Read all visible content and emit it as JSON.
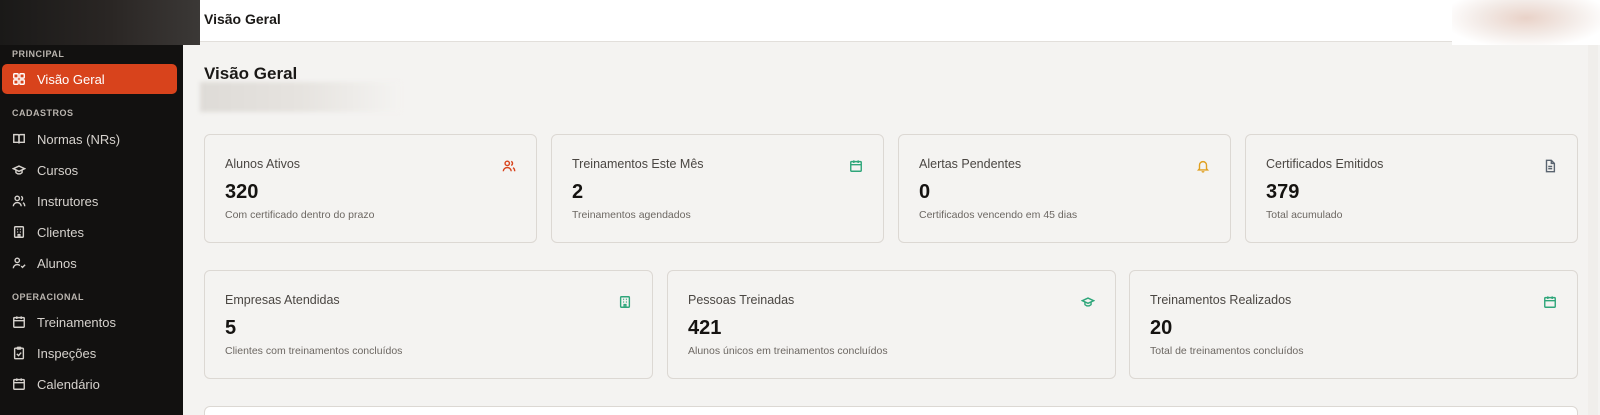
{
  "header": {
    "title": "Visão Geral"
  },
  "page": {
    "title": "Visão Geral"
  },
  "sidebar": {
    "sections": [
      {
        "label": "PRINCIPAL"
      },
      {
        "label": "CADASTROS"
      },
      {
        "label": "OPERACIONAL"
      }
    ],
    "items": [
      {
        "label": "Visão Geral",
        "icon": "dashboard-icon",
        "active": true
      },
      {
        "label": "Normas (NRs)",
        "icon": "book-icon"
      },
      {
        "label": "Cursos",
        "icon": "graduation-cap-icon"
      },
      {
        "label": "Instrutores",
        "icon": "users-icon"
      },
      {
        "label": "Clientes",
        "icon": "building-icon"
      },
      {
        "label": "Alunos",
        "icon": "user-check-icon"
      },
      {
        "label": "Treinamentos",
        "icon": "calendar-icon"
      },
      {
        "label": "Inspeções",
        "icon": "clipboard-check-icon"
      },
      {
        "label": "Calendário",
        "icon": "calendar-icon"
      }
    ]
  },
  "stats_row1": [
    {
      "label": "Alunos Ativos",
      "value": "320",
      "desc": "Com certificado dentro do prazo",
      "icon": "users-icon",
      "color": "#d8431c"
    },
    {
      "label": "Treinamentos Este Mês",
      "value": "2",
      "desc": "Treinamentos agendados",
      "icon": "calendar-icon",
      "color": "#2fa67a"
    },
    {
      "label": "Alertas Pendentes",
      "value": "0",
      "desc": "Certificados vencendo em 45 dias",
      "icon": "bell-icon",
      "color": "#e0a020"
    },
    {
      "label": "Certificados Emitidos",
      "value": "379",
      "desc": "Total acumulado",
      "icon": "file-icon",
      "color": "#5a6470"
    }
  ],
  "stats_row2": [
    {
      "label": "Empresas Atendidas",
      "value": "5",
      "desc": "Clientes com treinamentos concluídos",
      "icon": "building-icon",
      "color": "#2fa67a"
    },
    {
      "label": "Pessoas Treinadas",
      "value": "421",
      "desc": "Alunos únicos em treinamentos concluídos",
      "icon": "graduation-cap-icon",
      "color": "#2fa67a"
    },
    {
      "label": "Treinamentos Realizados",
      "value": "20",
      "desc": "Total de treinamentos concluídos",
      "icon": "calendar-icon",
      "color": "#2fa67a"
    }
  ]
}
